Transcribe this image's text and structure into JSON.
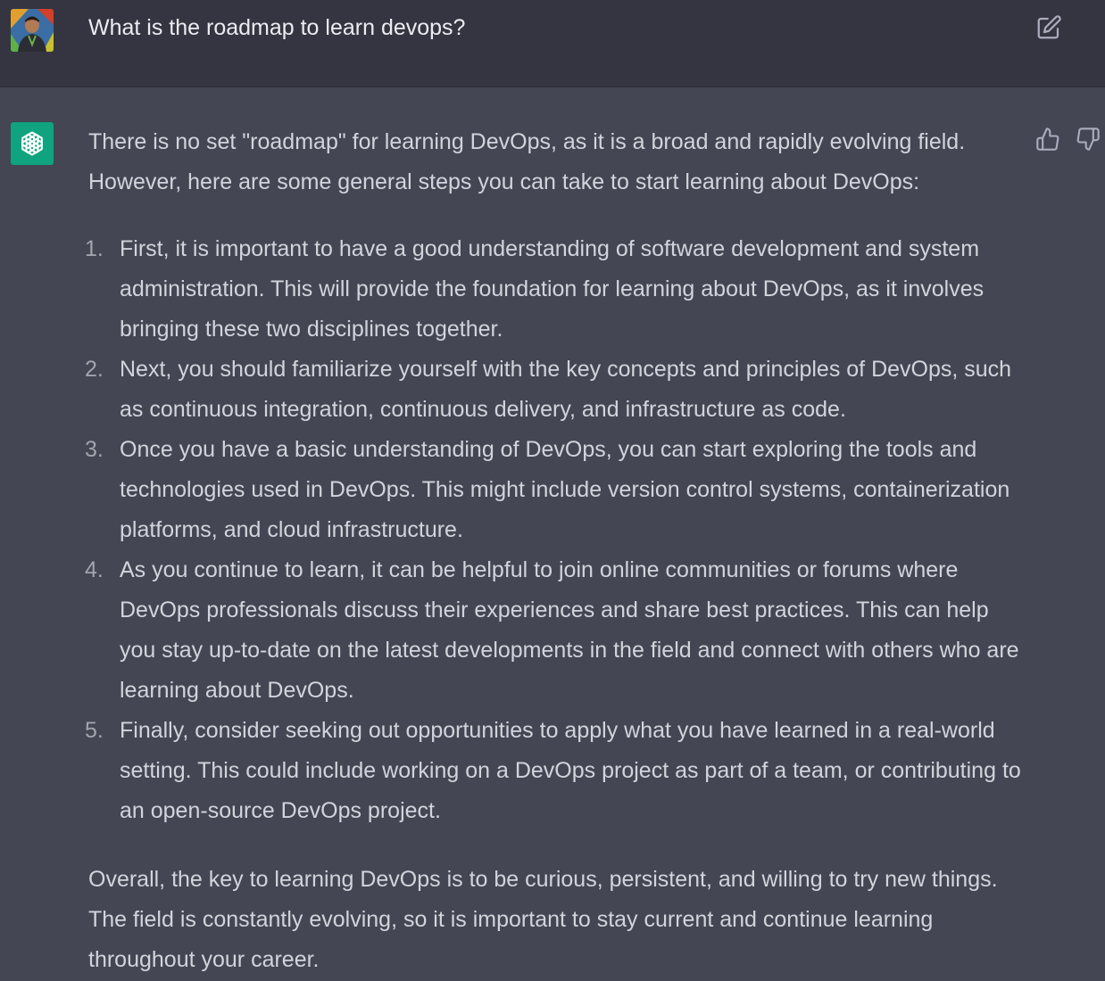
{
  "user_message": {
    "text": "What is the roadmap to learn devops?"
  },
  "assistant_message": {
    "intro": "There is no set \"roadmap\" for learning DevOps, as it is a broad and rapidly evolving field. However, here are some general steps you can take to start learning about DevOps:",
    "steps": [
      {
        "num": "1.",
        "text": "First, it is important to have a good understanding of software development and system administration. This will provide the foundation for learning about DevOps, as it involves bringing these two disciplines together."
      },
      {
        "num": "2.",
        "text": "Next, you should familiarize yourself with the key concepts and principles of DevOps, such as continuous integration, continuous delivery, and infrastructure as code."
      },
      {
        "num": "3.",
        "text": "Once you have a basic understanding of DevOps, you can start exploring the tools and technologies used in DevOps. This might include version control systems, containerization platforms, and cloud infrastructure."
      },
      {
        "num": "4.",
        "text": "As you continue to learn, it can be helpful to join online communities or forums where DevOps professionals discuss their experiences and share best practices. This can help you stay up-to-date on the latest developments in the field and connect with others who are learning about DevOps."
      },
      {
        "num": "5.",
        "text": "Finally, consider seeking out opportunities to apply what you have learned in a real-world setting. This could include working on a DevOps project as part of a team, or contributing to an open-source DevOps project."
      }
    ],
    "outro": "Overall, the key to learning DevOps is to be curious, persistent, and willing to try new things. The field is constantly evolving, so it is important to stay current and continue learning throughout your career."
  },
  "icons": {
    "edit": "edit-icon",
    "thumbs_up": "thumbs-up-icon",
    "thumbs_down": "thumbs-down-icon",
    "assistant_logo": "openai-logo-icon"
  },
  "colors": {
    "user_row_bg": "#343541",
    "assistant_row_bg": "#444654",
    "assistant_avatar_bg": "#10a37f"
  }
}
